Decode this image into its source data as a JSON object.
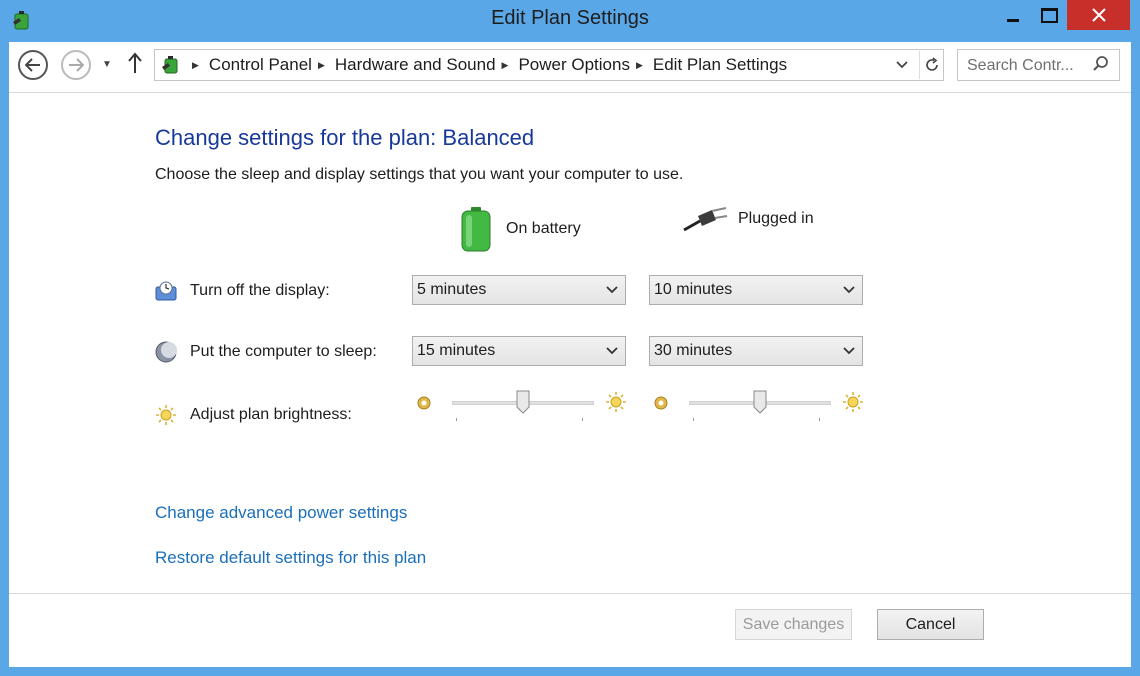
{
  "window": {
    "title": "Edit Plan Settings"
  },
  "nav": {
    "breadcrumb": [
      "Control Panel",
      "Hardware and Sound",
      "Power Options",
      "Edit Plan Settings"
    ],
    "search_placeholder": "Search Contr..."
  },
  "main": {
    "heading": "Change settings for the plan: Balanced",
    "description": "Choose the sleep and display settings that you want your computer to use.",
    "columns": {
      "battery": "On battery",
      "plugged": "Plugged in"
    },
    "rows": {
      "display": {
        "label": "Turn off the display:",
        "battery_value": "5 minutes",
        "plugged_value": "10 minutes"
      },
      "sleep": {
        "label": "Put the computer to sleep:",
        "battery_value": "15 minutes",
        "plugged_value": "30 minutes"
      },
      "brightness": {
        "label": "Adjust plan brightness:",
        "battery_level": 0.5,
        "plugged_level": 0.5
      }
    },
    "links": {
      "advanced": "Change advanced power settings",
      "restore": "Restore default settings for this plan"
    }
  },
  "footer": {
    "save_label": "Save changes",
    "cancel_label": "Cancel"
  },
  "colors": {
    "window_frame": "#5aa7e8",
    "heading": "#17399b",
    "link": "#1a6fb9",
    "close_button": "#c7302a"
  }
}
